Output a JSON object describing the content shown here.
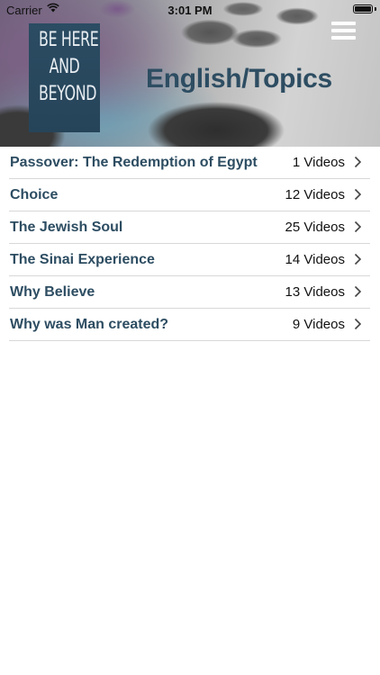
{
  "status_bar": {
    "carrier": "Carrier",
    "time": "3:01 PM"
  },
  "header": {
    "logo_lines": [
      "BE HERE",
      "AND",
      "BEYOND"
    ],
    "title": "English/Topics"
  },
  "topics": [
    {
      "title": "Passover: The Redemption of Egypt",
      "count": "1 Videos"
    },
    {
      "title": "Choice",
      "count": "12 Videos"
    },
    {
      "title": "The Jewish Soul",
      "count": "25 Videos"
    },
    {
      "title": "The Sinai Experience",
      "count": "14 Videos"
    },
    {
      "title": "Why Believe",
      "count": "13 Videos"
    },
    {
      "title": "Why was Man created?",
      "count": "9 Videos"
    }
  ],
  "colors": {
    "title_blue": "#2d4d62",
    "logo_bg": "#2b4c63",
    "divider": "#d8d8d8"
  },
  "icons": {
    "menu": "hamburger-menu-icon",
    "row_disclosure": "chevron-right-icon",
    "wifi": "wifi-icon",
    "battery": "battery-icon"
  }
}
